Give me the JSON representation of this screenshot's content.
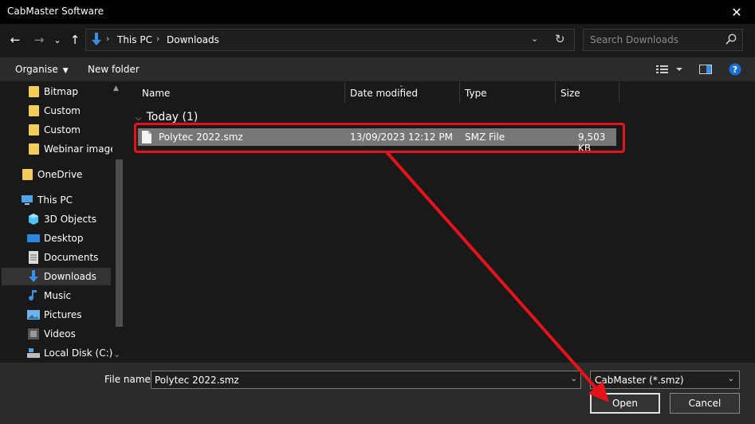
{
  "window": {
    "title": "CabMaster Software",
    "close_glyph": "✕"
  },
  "navbar": {
    "back_glyph": "←",
    "forward_glyph": "→",
    "recent_glyph": "⌄",
    "up_glyph": "↑",
    "address": {
      "segments": [
        "This PC",
        "Downloads"
      ],
      "separator": "›",
      "dropdown_glyph": "⌄",
      "refresh_glyph": "↻"
    },
    "search": {
      "placeholder": "Search Downloads"
    }
  },
  "toolbar": {
    "organise": "Organise",
    "new_folder": "New folder",
    "caret": "▼"
  },
  "sidebar": {
    "items": [
      {
        "label": "Bitmap",
        "icon": "folder-icon"
      },
      {
        "label": "Custom",
        "icon": "folder-icon"
      },
      {
        "label": "Custom",
        "icon": "folder-icon"
      },
      {
        "label": "Webinar images",
        "icon": "folder-icon"
      },
      {
        "label": "OneDrive",
        "icon": "folder-icon"
      },
      {
        "label": "This PC",
        "icon": "computer-icon"
      },
      {
        "label": "3D Objects",
        "icon": "cube-icon"
      },
      {
        "label": "Desktop",
        "icon": "desktop-icon"
      },
      {
        "label": "Documents",
        "icon": "document-icon"
      },
      {
        "label": "Downloads",
        "icon": "download-icon",
        "selected": true
      },
      {
        "label": "Music",
        "icon": "music-icon"
      },
      {
        "label": "Pictures",
        "icon": "picture-icon"
      },
      {
        "label": "Videos",
        "icon": "video-icon"
      },
      {
        "label": "Local Disk (C:)",
        "icon": "disk-icon"
      }
    ],
    "scroll_up": "▲",
    "scroll_down": "⌄"
  },
  "columns": [
    "Name",
    "Date modified",
    "Type",
    "Size"
  ],
  "group": {
    "label": "Today (1)",
    "caret": "⌵"
  },
  "files": [
    {
      "name": "Polytec 2022.smz",
      "date_modified": "13/09/2023 12:12 PM",
      "type": "SMZ File",
      "size": "9,503 KB"
    }
  ],
  "footer": {
    "file_name_label": "File name:",
    "file_name_value": "Polytec 2022.smz",
    "file_type_value": "CabMaster (*.smz)",
    "dropdown_glyph": "⌄",
    "open_label": "Open",
    "cancel_label": "Cancel"
  },
  "colors": {
    "accent": "#e5121a",
    "folder": "#f3cd5c",
    "blue": "#3a8ee6"
  }
}
